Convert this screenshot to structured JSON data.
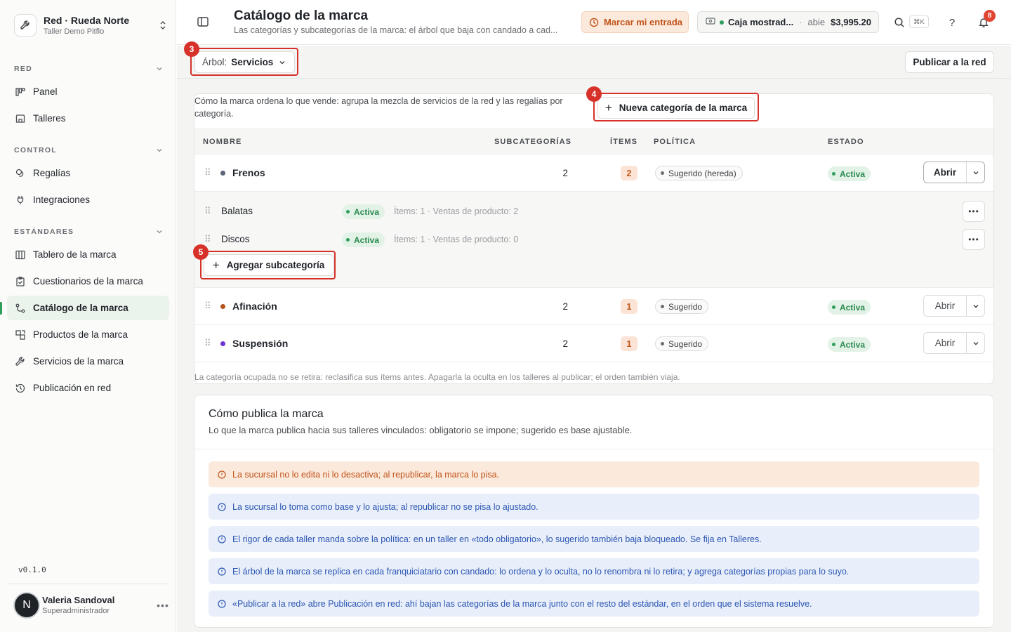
{
  "sidebar": {
    "org_name": "Red · Rueda Norte",
    "org_sub": "Taller Demo Pitflo",
    "sections": [
      {
        "title": "RED",
        "items": [
          "Panel",
          "Talleres"
        ]
      },
      {
        "title": "CONTROL",
        "items": [
          "Regalías",
          "Integraciones"
        ]
      },
      {
        "title": "ESTÁNDARES",
        "items": [
          "Tablero de la marca",
          "Cuestionarios de la marca",
          "Catálogo de la marca",
          "Productos de la marca",
          "Servicios de la marca",
          "Publicación en red"
        ]
      }
    ],
    "active_item": "Catálogo de la marca",
    "version": "v0.1.0",
    "user": {
      "initial": "N",
      "name": "Valeria Sandoval",
      "role": "Superadministrador"
    }
  },
  "header": {
    "title": "Catálogo de la marca",
    "subtitle": "Las categorías y subcategorías de la marca: el árbol que baja con candado a cad...",
    "clock_label": "Marcar mi entrada",
    "cash": {
      "name": "Caja mostrad...",
      "state": "abie",
      "amount": "$3,995.20"
    },
    "shortcut": "⌘K",
    "help": "?",
    "notifications": "8"
  },
  "toolbar": {
    "tree_label": "Árbol:",
    "tree_value": "Servicios",
    "publish_label": "Publicar a la red"
  },
  "markers": [
    "3",
    "4",
    "5"
  ],
  "catalog": {
    "intro": "Cómo la marca ordena lo que vende: agrupa la mezcla de servicios de la red y las regalías por categoría.",
    "new_category_label": "Nueva categoría de la marca",
    "columns": [
      "NOMBRE",
      "SUBCATEGORÍAS",
      "ÍTEMS",
      "POLÍTICA",
      "ESTADO"
    ],
    "rows": [
      {
        "name": "Frenos",
        "color": "#5b6478",
        "subcategories": "2",
        "items": "2",
        "policy": "Sugerido (hereda)",
        "status": "Activa",
        "action": "Abrir"
      },
      {
        "name": "Afinación",
        "color": "#b5541c",
        "subcategories": "2",
        "items": "1",
        "policy": "Sugerido",
        "status": "Activa",
        "action": "Abrir"
      },
      {
        "name": "Suspensión",
        "color": "#6d34d4",
        "subcategories": "2",
        "items": "1",
        "policy": "Sugerido",
        "status": "Activa",
        "action": "Abrir"
      }
    ],
    "subrows": [
      {
        "name": "Balatas",
        "status": "Activa",
        "meta": "Ítems: 1 · Ventas de producto: 2"
      },
      {
        "name": "Discos",
        "status": "Activa",
        "meta": "Ítems: 1 · Ventas de producto: 0"
      }
    ],
    "add_sub_label": "Agregar subcategoría",
    "footnote": "La categoría ocupada no se retira: reclasifica sus ítems antes. Apagarla la oculta en los talleres al publicar; el orden también viaja."
  },
  "publish_info": {
    "title": "Cómo publica la marca",
    "subtitle": "Lo que la marca publica hacia sus talleres vinculados: obligatorio se impone; sugerido es base ajustable.",
    "alerts": [
      {
        "type": "warn",
        "text": "La sucursal no lo edita ni lo desactiva; al republicar, la marca lo pisa."
      },
      {
        "type": "info",
        "text": "La sucursal lo toma como base y lo ajusta; al republicar no se pisa lo ajustado."
      },
      {
        "type": "info",
        "text": "El rigor de cada taller manda sobre la política: en un taller en «todo obligatorio», lo sugerido también baja bloqueado. Se fija en Talleres."
      },
      {
        "type": "info",
        "text": "El árbol de la marca se replica en cada franquiciatario con candado: lo ordena y lo oculta, no lo renombra ni lo retira; y agrega categorías propias para lo suyo."
      },
      {
        "type": "info",
        "text": "«Publicar a la red» abre Publicación en red: ahí bajan las categorías de la marca junto con el resto del estándar, en el orden que el sistema resuelve."
      }
    ]
  },
  "colors": {
    "accent": "#2f9e5a",
    "highlight": "#d6322a",
    "warn": "#c2541a",
    "info": "#2c55b3"
  }
}
